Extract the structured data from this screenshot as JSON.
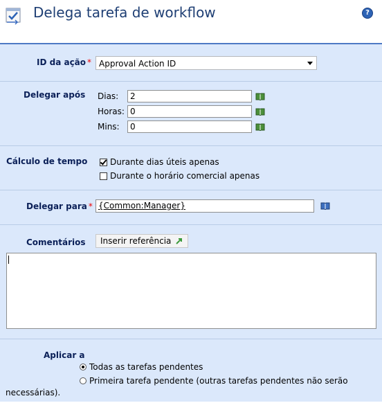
{
  "header": {
    "title": "Delega tarefa de workflow",
    "help_icon": "help-icon",
    "workflow_icon": "workflow-delegate-icon"
  },
  "action_id": {
    "label": "ID da ação",
    "required_mark": "*",
    "selected": "Approval Action ID"
  },
  "delegate_after": {
    "label": "Delegar após",
    "fields": [
      {
        "label": "Dias:",
        "value": "2"
      },
      {
        "label": "Horas:",
        "value": "0"
      },
      {
        "label": "Mins:",
        "value": "0"
      }
    ]
  },
  "time_calc": {
    "label": "Cálculo de tempo",
    "options": [
      {
        "label": "Durante dias úteis apenas",
        "checked": true
      },
      {
        "label": "Durante o horário comercial apenas",
        "checked": false
      }
    ]
  },
  "delegate_to": {
    "label": "Delegar para",
    "required_mark": "*",
    "value": "{Common:Manager}"
  },
  "comments": {
    "label": "Comentários",
    "insert_button": "Inserir referência",
    "value": ""
  },
  "apply_to": {
    "label": "Aplicar a",
    "options": [
      {
        "label": "Todas as tarefas pendentes",
        "selected": true
      },
      {
        "label": "Primeira tarefa pendente (outras tarefas pendentes não serão",
        "continuation": "necessárias).",
        "selected": false
      }
    ]
  },
  "colors": {
    "panel": "#dbe8fb",
    "title": "#1f3f74",
    "label": "#0b2058",
    "required": "#e00000"
  }
}
